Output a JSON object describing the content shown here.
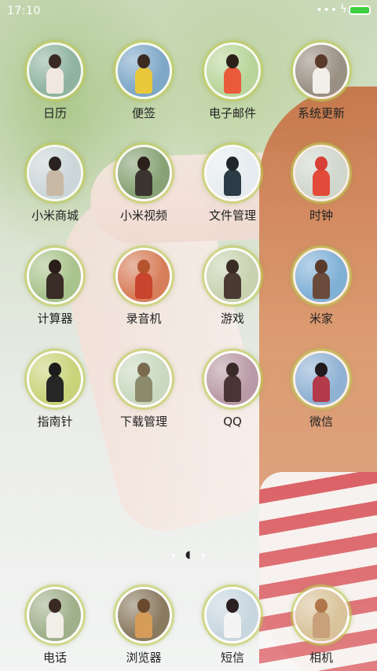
{
  "status_bar": {
    "time": "17:10",
    "signal_dots": "•••",
    "charging_symbol": "ϟ",
    "battery_color": "#3fcf3f"
  },
  "apps": [
    {
      "label": "日历",
      "icon": "calendar-photo-icon",
      "bg": "#8fb3a0",
      "fig": "#f0e8e0",
      "head": "#3a2a24"
    },
    {
      "label": "便签",
      "icon": "notes-photo-icon",
      "bg": "#7ea7c8",
      "fig": "#e9c73a",
      "head": "#3b2c22"
    },
    {
      "label": "电子邮件",
      "icon": "email-photo-icon",
      "bg": "#b9d59a",
      "fig": "#e85a3a",
      "head": "#2c201b"
    },
    {
      "label": "系统更新",
      "icon": "system-update-photo-icon",
      "bg": "#9a8f83",
      "fig": "#f2efe9",
      "head": "#5a3a2a"
    },
    {
      "label": "小米商城",
      "icon": "mi-store-photo-icon",
      "bg": "#cbd6d9",
      "fig": "#c8b9a6",
      "head": "#2a2220"
    },
    {
      "label": "小米视频",
      "icon": "mi-video-photo-icon",
      "bg": "#88a275",
      "fig": "#3c3430",
      "head": "#2c201b"
    },
    {
      "label": "文件管理",
      "icon": "file-manager-photo-icon",
      "bg": "#e6ecef",
      "fig": "#2c3c46",
      "head": "#20262a"
    },
    {
      "label": "时钟",
      "icon": "clock-photo-icon",
      "bg": "#d0d7cd",
      "fig": "#e24b3a",
      "head": "#d64036"
    },
    {
      "label": "计算器",
      "icon": "calculator-photo-icon",
      "bg": "#a9c38c",
      "fig": "#3a2c26",
      "head": "#2a1e1a"
    },
    {
      "label": "录音机",
      "icon": "recorder-photo-icon",
      "bg": "#d77e5a",
      "fig": "#c8442c",
      "head": "#b4542e"
    },
    {
      "label": "游戏",
      "icon": "games-photo-icon",
      "bg": "#c8d2b0",
      "fig": "#4a3a32",
      "head": "#3a2c24"
    },
    {
      "label": "米家",
      "icon": "mijia-photo-icon",
      "bg": "#7fb0d6",
      "fig": "#6a4a3a",
      "head": "#5a3a2c"
    },
    {
      "label": "指南针",
      "icon": "compass-photo-icon",
      "bg": "#c9d37a",
      "fig": "#262626",
      "head": "#1c1c1c"
    },
    {
      "label": "下载管理",
      "icon": "download-manager-photo-icon",
      "bg": "#c9d9c0",
      "fig": "#8c8a6c",
      "head": "#7a6a50"
    },
    {
      "label": "QQ",
      "icon": "qq-photo-icon",
      "bg": "#b99aa6",
      "fig": "#4a3436",
      "head": "#3a2a2a"
    },
    {
      "label": "微信",
      "icon": "wechat-photo-icon",
      "bg": "#8fb2d4",
      "fig": "#b23a4a",
      "head": "#201a1c"
    },
    {
      "label": "电话",
      "icon": "phone-photo-icon",
      "bg": "#9fb08a",
      "fig": "#f2eee8",
      "head": "#3a2a24"
    },
    {
      "label": "浏览器",
      "icon": "browser-photo-icon",
      "bg": "#8a7a60",
      "fig": "#d69c5a",
      "head": "#6a4a2e"
    },
    {
      "label": "短信",
      "icon": "messages-photo-icon",
      "bg": "#c8d6e0",
      "fig": "#f4f4f4",
      "head": "#2a2020"
    },
    {
      "label": "相机",
      "icon": "camera-photo-icon",
      "bg": "#d9c39a",
      "fig": "#c8a07a",
      "head": "#b0764a"
    }
  ],
  "pager": {
    "active_glyph": "◖"
  }
}
